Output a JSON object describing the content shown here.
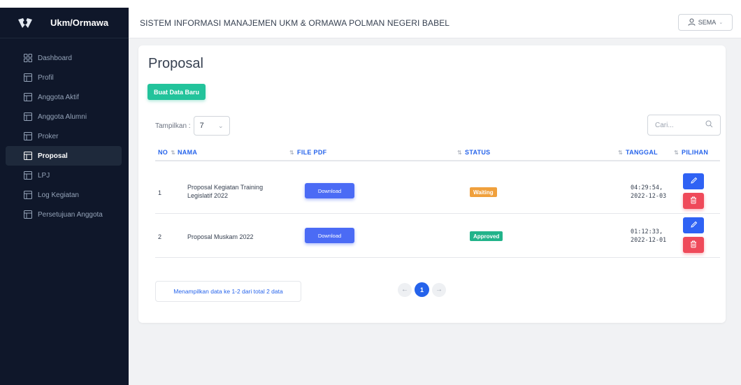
{
  "sidebar": {
    "brand": "Ukm/Ormawa",
    "items": [
      {
        "label": "Dashboard",
        "icon": "dashboard-grid-icon",
        "active": false
      },
      {
        "label": "Profil",
        "icon": "table-icon",
        "active": false
      },
      {
        "label": "Anggota Aktif",
        "icon": "table-icon",
        "active": false
      },
      {
        "label": "Anggota Alumni",
        "icon": "table-icon",
        "active": false
      },
      {
        "label": "Proker",
        "icon": "table-icon",
        "active": false
      },
      {
        "label": "Proposal",
        "icon": "table-icon",
        "active": true
      },
      {
        "label": "LPJ",
        "icon": "table-icon",
        "active": false
      },
      {
        "label": "Log Kegiatan",
        "icon": "table-icon",
        "active": false
      },
      {
        "label": "Persetujuan Anggota",
        "icon": "table-icon",
        "active": false
      }
    ]
  },
  "header": {
    "title": "SISTEM INFORMASI MANAJEMEN UKM & ORMAWA POLMAN NEGERI BABEL",
    "user": "SEMA"
  },
  "page": {
    "title": "Proposal",
    "new_button": "Buat Data Baru",
    "show_label": "Tampilkan :",
    "show_value": "7",
    "search_placeholder": "Cari..."
  },
  "table": {
    "columns": [
      "NO",
      "NAMA",
      "FILE PDF",
      "STATUS",
      "TANGGAL",
      "PILIHAN"
    ],
    "rows": [
      {
        "no": "1",
        "nama_line1": "Proposal Kegiatan Training",
        "nama_line2": "Legislatif 2022",
        "file": "Download",
        "status": "Waiting",
        "time": "04:29:54,",
        "date": "2022-12-03"
      },
      {
        "no": "2",
        "nama_line1": "Proposal Muskam 2022",
        "nama_line2": "",
        "file": "Download",
        "status": "Approved",
        "time": "01:12:33,",
        "date": "2022-12-01"
      }
    ]
  },
  "footer": {
    "info": "Menampilkan data ke 1-2 dari total 2 data",
    "current_page": "1"
  },
  "colors": {
    "sidebar_bg": "#0f172a",
    "accent": "#2563eb",
    "primary_button": "#22c39b",
    "download_button": "#4b6bf5",
    "waiting": "#f0a03c",
    "approved": "#22b38a",
    "delete": "#ef4a5a"
  }
}
